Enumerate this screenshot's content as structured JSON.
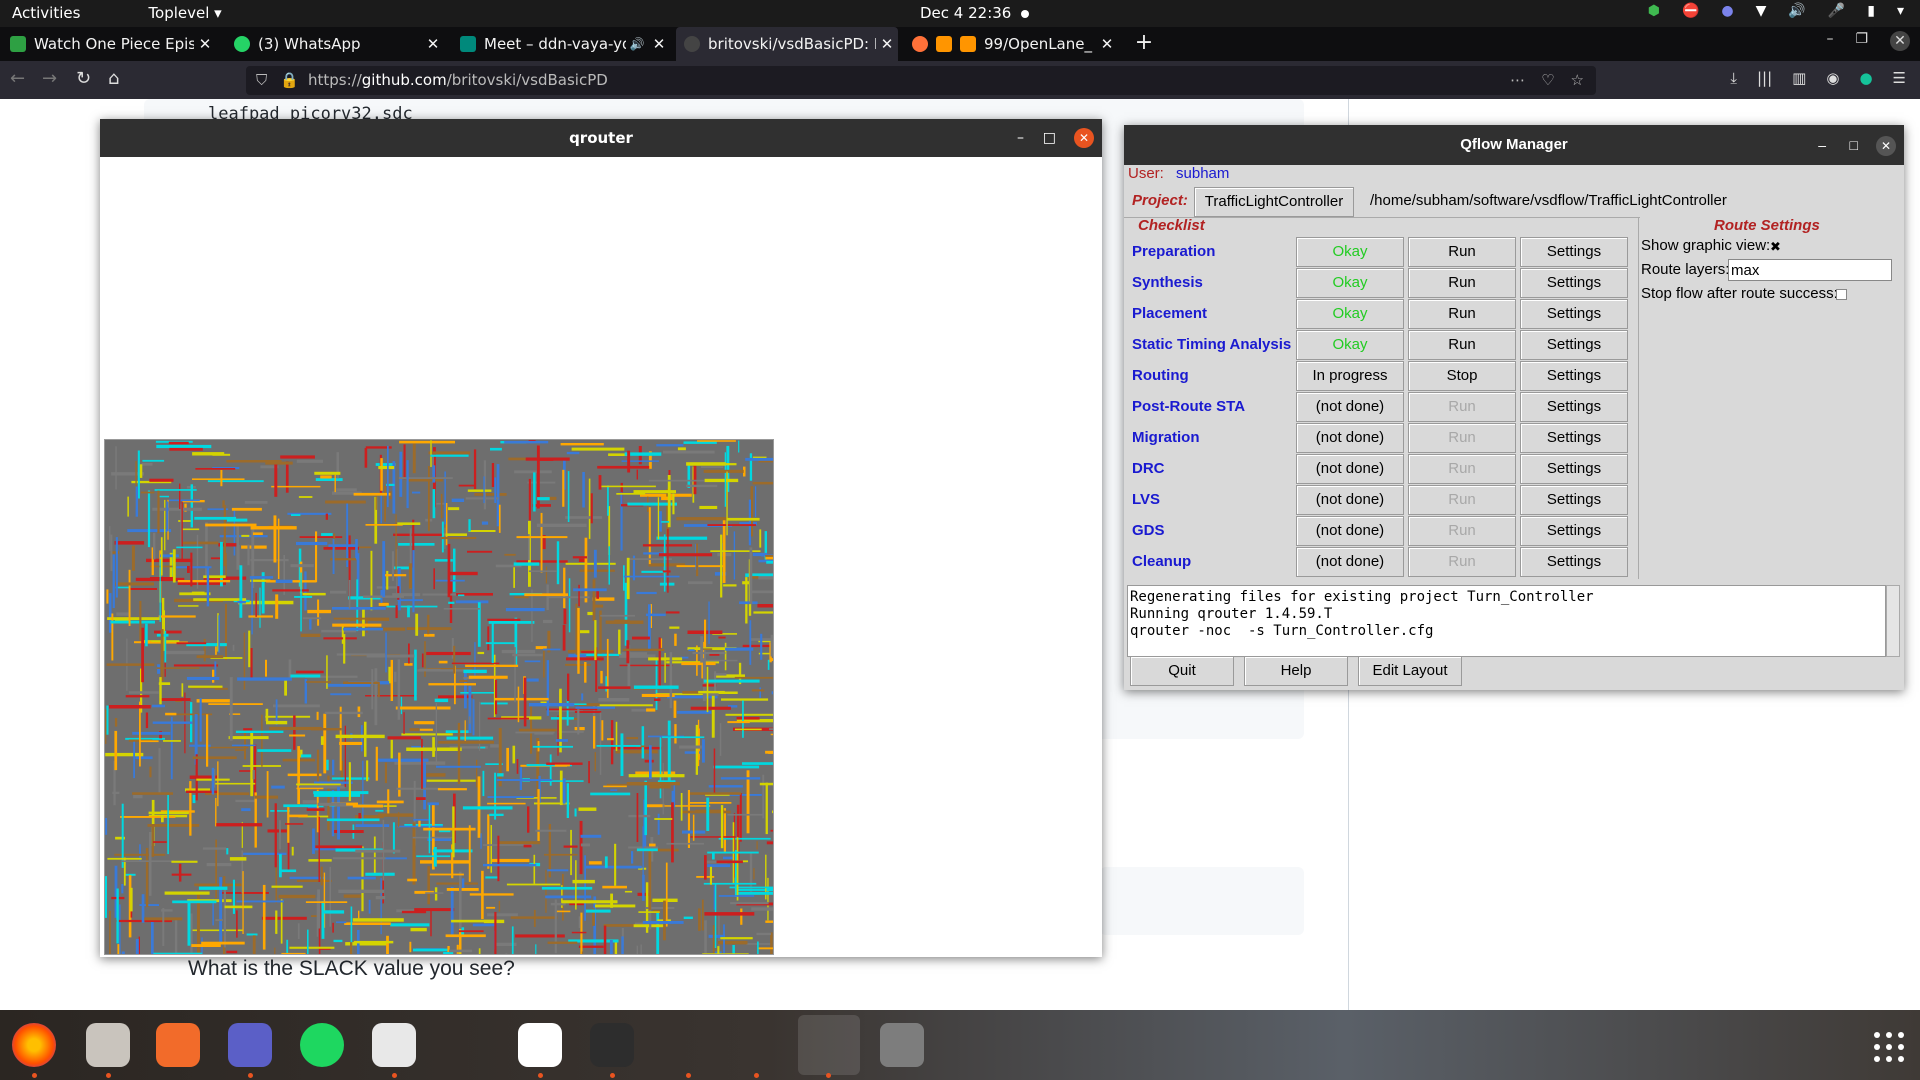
{
  "topbar": {
    "activities": "Activities",
    "app_menu": "Toplevel ▾",
    "clock": "Dec 4  22:36"
  },
  "browser": {
    "tabs": [
      {
        "title": "Watch One Piece Episode",
        "icon_color": "#2ea043",
        "close": "✕"
      },
      {
        "title": "(3) WhatsApp",
        "icon_color": "#25d366",
        "close": "✕"
      },
      {
        "title": "Meet – ddn-vaya-yqt",
        "icon_color": "#00897b",
        "close": "✕",
        "audio": "🔊"
      },
      {
        "title": "britovski/vsdBasicPD: Ph",
        "icon_color": "#333333",
        "close": "✕"
      },
      {
        "title": "99/OpenLane_",
        "icon_color": "#ff9500",
        "close": "✕"
      }
    ],
    "new_tab": "+",
    "url_prefix": "https://",
    "url_host": "github.com",
    "url_path": "/britovski/vsdBasicPD"
  },
  "page": {
    "code_line": "leafpad picorv32.sdc",
    "question": "What is the SLACK value you see?"
  },
  "qrouter": {
    "title": "qrouter",
    "colors": [
      "#00d8e0",
      "#ffa800",
      "#cc1f1f",
      "#7a7a7a",
      "#3a7ad8",
      "#d4d400",
      "#9c6b2a"
    ]
  },
  "qflow": {
    "title": "Qflow Manager",
    "user_label": "User:",
    "user_name": "subham",
    "project_label": "Project:",
    "project_name": "TrafficLightController",
    "project_path": "/home/subham/software/vsdflow/TrafficLightController",
    "checklist_label": "Checklist",
    "route_settings_label": "Route Settings",
    "stages": [
      {
        "name": "Preparation",
        "status": "Okay",
        "action": "Run",
        "settings": "Settings"
      },
      {
        "name": "Synthesis",
        "status": "Okay",
        "action": "Run",
        "settings": "Settings"
      },
      {
        "name": "Placement",
        "status": "Okay",
        "action": "Run",
        "settings": "Settings"
      },
      {
        "name": "Static Timing Analysis",
        "status": "Okay",
        "action": "Run",
        "settings": "Settings"
      },
      {
        "name": "Routing",
        "status": "In progress",
        "action": "Stop",
        "settings": "Settings"
      },
      {
        "name": "Post-Route STA",
        "status": "(not done)",
        "action": "Run",
        "settings": "Settings"
      },
      {
        "name": "Migration",
        "status": "(not done)",
        "action": "Run",
        "settings": "Settings"
      },
      {
        "name": "DRC",
        "status": "(not done)",
        "action": "Run",
        "settings": "Settings"
      },
      {
        "name": "LVS",
        "status": "(not done)",
        "action": "Run",
        "settings": "Settings"
      },
      {
        "name": "GDS",
        "status": "(not done)",
        "action": "Run",
        "settings": "Settings"
      },
      {
        "name": "Cleanup",
        "status": "(not done)",
        "action": "Run",
        "settings": "Settings"
      }
    ],
    "route": {
      "show_graphic_label": "Show graphic view:",
      "show_graphic_checked": true,
      "route_layers_label": "Route layers:",
      "route_layers_value": "max",
      "stop_flow_label": "Stop flow after route success:",
      "stop_flow_checked": false
    },
    "log": "Regenerating files for existing project Turn_Controller\nRunning qrouter 1.4.59.T\nqrouter -noc  -s Turn_Controller.cfg",
    "buttons": {
      "quit": "Quit",
      "help": "Help",
      "edit_layout": "Edit Layout"
    },
    "colors": {
      "stage": "#1a1ad0",
      "okay": "#22cc22",
      "label": "#b22222"
    }
  }
}
